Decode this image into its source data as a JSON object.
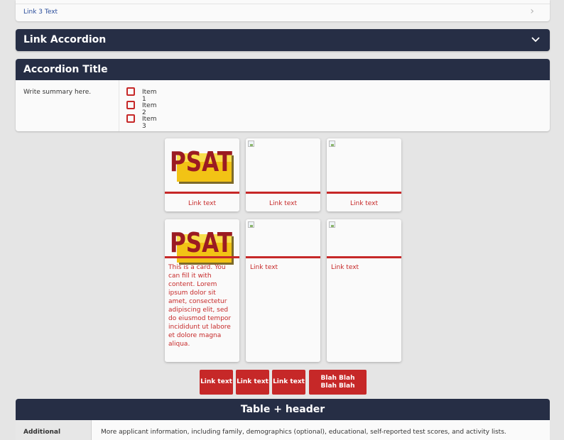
{
  "link_row": {
    "text": "Link 3 Text",
    "icon": "chevron-right-icon"
  },
  "link_accordion": {
    "title": "Link Accordion",
    "icon": "chevron-down-icon"
  },
  "accordion": {
    "title": "Accordion Title",
    "summary": "Write summary here.",
    "items": [
      "Item 1",
      "Item 2",
      "Item 3"
    ]
  },
  "cards_row1": [
    {
      "image": "psat-logo",
      "link": "Link text"
    },
    {
      "image": "broken-image-icon",
      "link": "Link text"
    },
    {
      "image": "broken-image-icon",
      "link": "Link text"
    }
  ],
  "cards_row2": [
    {
      "image": "psat-logo",
      "body": "This is a card. You can fill it with content. Lorem ipsum dolor sit amet, consectetur adipiscing elit, sed do eiusmod tempor incididunt ut labore et dolore magna aliqua."
    },
    {
      "image": "broken-image-icon",
      "link": "Link text"
    },
    {
      "image": "broken-image-icon",
      "link": "Link text"
    }
  ],
  "logo_text": "PSAT",
  "buttons": [
    "Link text",
    "Link text",
    "Link text",
    "Blah Blah Blah Blah"
  ],
  "table": {
    "header": "Table + header",
    "row_label": "Additional",
    "row_value": "More applicant information, including family, demographics (optional), educational, self-reported test scores, and activity lists."
  },
  "colors": {
    "navy": "#262e45",
    "accent_red": "#c62828",
    "background": "#e5e5e5"
  }
}
